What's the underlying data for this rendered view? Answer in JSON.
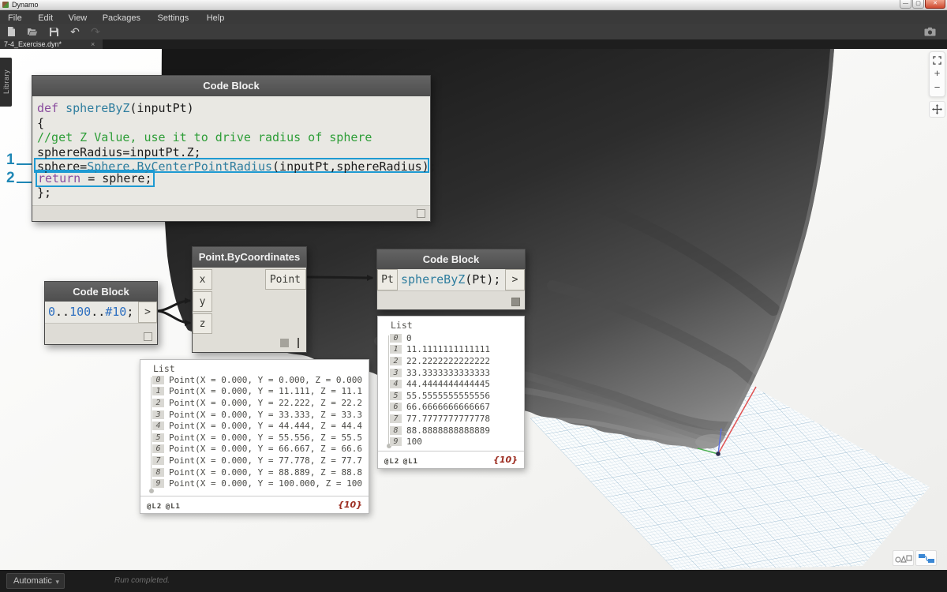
{
  "window": {
    "title": "Dynamo"
  },
  "menu": {
    "items": [
      "File",
      "Edit",
      "View",
      "Packages",
      "Settings",
      "Help"
    ]
  },
  "toolbar": {
    "icons": [
      "new-file-icon",
      "open-file-icon",
      "save-icon",
      "undo-icon",
      "redo-icon",
      "camera-icon"
    ]
  },
  "tabs": {
    "active": "7-4_Exercise.dyn*",
    "close": "×"
  },
  "library": {
    "label": "Library"
  },
  "annotations": [
    {
      "label": "1"
    },
    {
      "label": "2"
    }
  ],
  "nodes": {
    "function_block": {
      "title": "Code Block",
      "lines": [
        {
          "segs": [
            {
              "t": "def ",
              "c": "kw"
            },
            {
              "t": "sphereByZ",
              "c": "fn"
            },
            {
              "t": "(inputPt)",
              "c": "pl"
            }
          ]
        },
        {
          "segs": [
            {
              "t": "{",
              "c": "pl"
            }
          ]
        },
        {
          "segs": [
            {
              "t": "//get Z Value, use it to drive radius of sphere",
              "c": "cm"
            }
          ]
        },
        {
          "segs": [
            {
              "t": "sphereRadius=inputPt.Z;",
              "c": "pl"
            }
          ]
        },
        {
          "h": "full",
          "segs": [
            {
              "t": "sphere=",
              "c": "pl"
            },
            {
              "t": "Sphere.ByCenterPointRadius",
              "c": "fn"
            },
            {
              "t": "(inputPt,sphereRadius);",
              "c": "pl"
            }
          ]
        },
        {
          "h": "inline",
          "segs": [
            {
              "t": "return",
              "c": "kw"
            },
            {
              "t": " = sphere;",
              "c": "pl"
            }
          ]
        },
        {
          "segs": [
            {
              "t": "};",
              "c": "pl"
            }
          ]
        }
      ]
    },
    "range_block": {
      "title": "Code Block",
      "output_label": ">",
      "segs": [
        {
          "t": "0",
          "c": "num"
        },
        {
          "t": "..",
          "c": "pl"
        },
        {
          "t": "100",
          "c": "num"
        },
        {
          "t": "..",
          "c": "pl"
        },
        {
          "t": "#10",
          "c": "num"
        },
        {
          "t": ";",
          "c": "pl"
        }
      ]
    },
    "point_node": {
      "title": "Point.ByCoordinates",
      "inputs": [
        "x",
        "y",
        "z"
      ],
      "output": "Point"
    },
    "call_block": {
      "title": "Code Block",
      "input_label": "Pt",
      "output_label": ">",
      "segs": [
        {
          "t": "sphereByZ",
          "c": "fn"
        },
        {
          "t": "(Pt);",
          "c": "pl"
        }
      ]
    }
  },
  "lists": {
    "values_list": {
      "header": "List",
      "lacing": [
        "@L2",
        "@L1"
      ],
      "count": "{10}",
      "items": [
        [
          "0",
          "0"
        ],
        [
          "1",
          "11.1111111111111"
        ],
        [
          "2",
          "22.2222222222222"
        ],
        [
          "3",
          "33.3333333333333"
        ],
        [
          "4",
          "44.4444444444445"
        ],
        [
          "5",
          "55.5555555555556"
        ],
        [
          "6",
          "66.6666666666667"
        ],
        [
          "7",
          "77.7777777777778"
        ],
        [
          "8",
          "88.8888888888889"
        ],
        [
          "9",
          "100"
        ]
      ]
    },
    "points_list": {
      "header": "List",
      "lacing": [
        "@L2",
        "@L1"
      ],
      "count": "{10}",
      "items": [
        [
          "0",
          "Point(X = 0.000, Y = 0.000, Z = 0.000"
        ],
        [
          "1",
          "Point(X = 0.000, Y = 11.111, Z = 11.1"
        ],
        [
          "2",
          "Point(X = 0.000, Y = 22.222, Z = 22.2"
        ],
        [
          "3",
          "Point(X = 0.000, Y = 33.333, Z = 33.3"
        ],
        [
          "4",
          "Point(X = 0.000, Y = 44.444, Z = 44.4"
        ],
        [
          "5",
          "Point(X = 0.000, Y = 55.556, Z = 55.5"
        ],
        [
          "6",
          "Point(X = 0.000, Y = 66.667, Z = 66.6"
        ],
        [
          "7",
          "Point(X = 0.000, Y = 77.778, Z = 77.7"
        ],
        [
          "8",
          "Point(X = 0.000, Y = 88.889, Z = 88.8"
        ],
        [
          "9",
          "Point(X = 0.000, Y = 100.000, Z = 100"
        ]
      ]
    }
  },
  "viewport": {
    "zoom_in_label": "+",
    "zoom_out_label": "−",
    "nav_icons": [
      "fit-view-icon",
      "zoom-in",
      "zoom-out",
      "pan-icon"
    ],
    "toggle_icons": [
      "geometry-view-icon",
      "graph-view-icon"
    ]
  },
  "statusbar": {
    "run_mode": "Automatic",
    "caret": "▾",
    "status": "Run completed."
  },
  "colors": {
    "accent_callout": "#1f87b5",
    "highlight_border": "#1e9ad2",
    "keyword": "#8a4c9e",
    "function_name": "#2e7d9e",
    "comment": "#2e9e38",
    "number_literal": "#2d6fc0",
    "wire": "#1c1c1c",
    "list_count": "#9c2c20",
    "graph_toggle_blue": "#3a87d4"
  }
}
